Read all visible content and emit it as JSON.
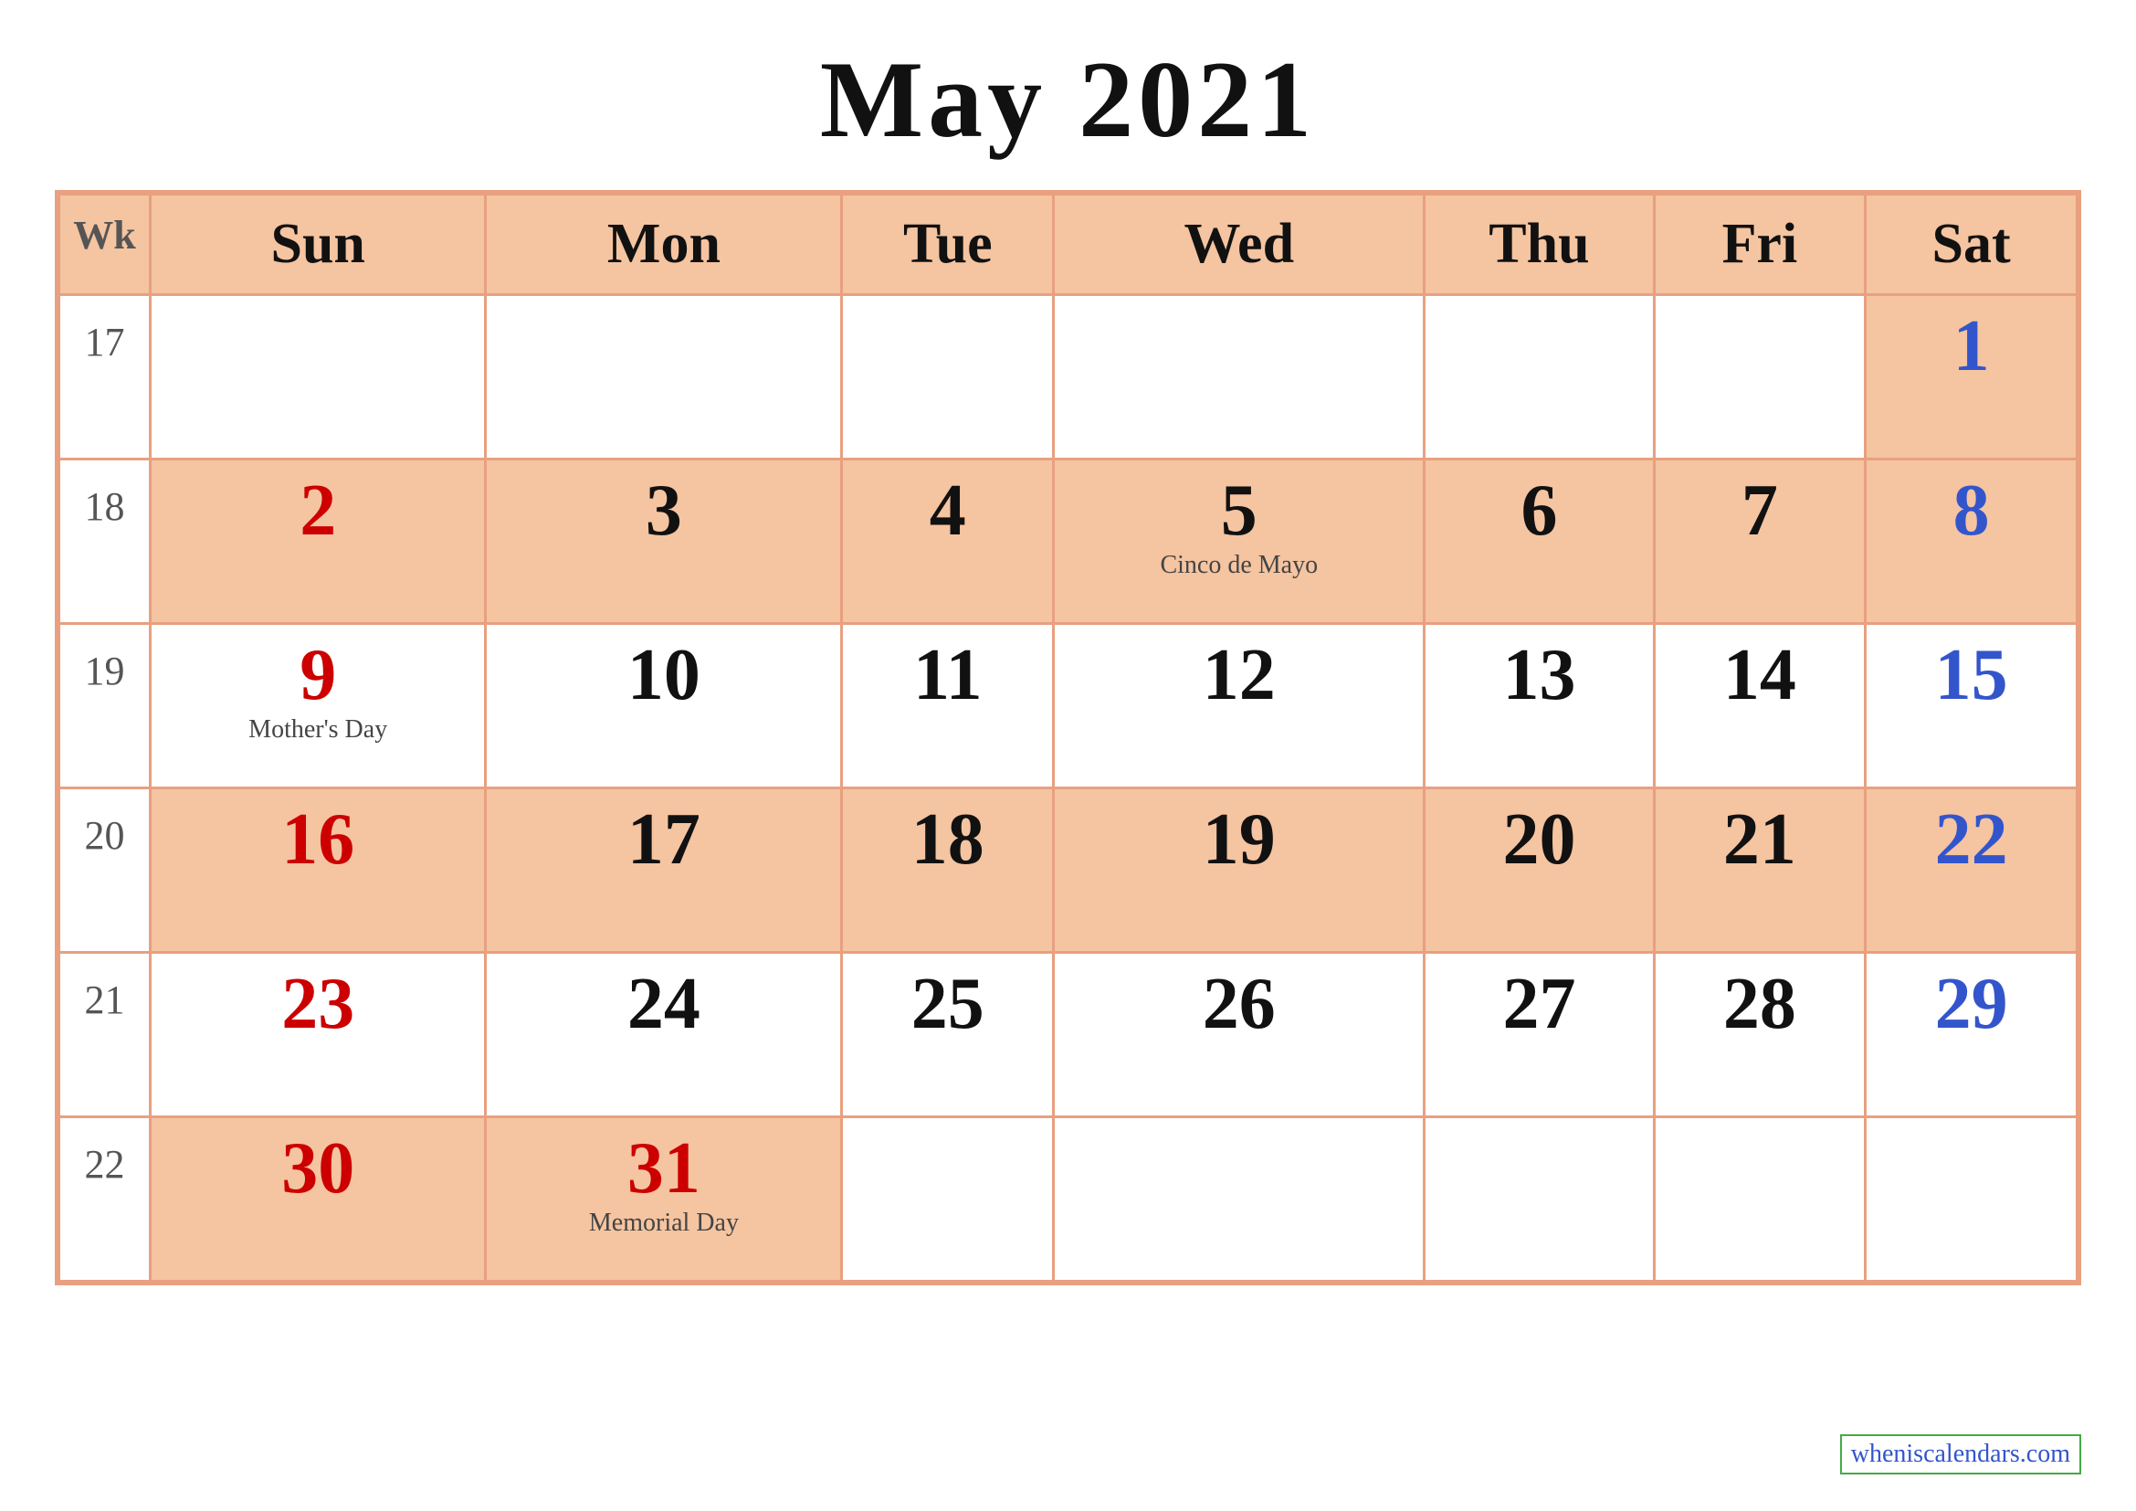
{
  "title": "May 2021",
  "headers": {
    "wk": "Wk",
    "sun": "Sun",
    "mon": "Mon",
    "tue": "Tue",
    "wed": "Wed",
    "thu": "Thu",
    "fri": "Fri",
    "sat": "Sat"
  },
  "weeks": [
    {
      "wk": "17",
      "days": [
        {
          "num": "",
          "holiday": "",
          "colorClass": "sun-color",
          "empty": true
        },
        {
          "num": "",
          "holiday": "",
          "colorClass": "weekday-color",
          "empty": true
        },
        {
          "num": "",
          "holiday": "",
          "colorClass": "weekday-color",
          "empty": true
        },
        {
          "num": "",
          "holiday": "",
          "colorClass": "weekday-color",
          "empty": true
        },
        {
          "num": "",
          "holiday": "",
          "colorClass": "weekday-color",
          "empty": true
        },
        {
          "num": "",
          "holiday": "",
          "colorClass": "weekday-color",
          "empty": true
        },
        {
          "num": "1",
          "holiday": "",
          "colorClass": "sat-color",
          "empty": false
        }
      ]
    },
    {
      "wk": "18",
      "days": [
        {
          "num": "2",
          "holiday": "",
          "colorClass": "sun-color",
          "empty": false
        },
        {
          "num": "3",
          "holiday": "",
          "colorClass": "weekday-color",
          "empty": false
        },
        {
          "num": "4",
          "holiday": "",
          "colorClass": "weekday-color",
          "empty": false
        },
        {
          "num": "5",
          "holiday": "Cinco de Mayo",
          "colorClass": "weekday-color",
          "empty": false
        },
        {
          "num": "6",
          "holiday": "",
          "colorClass": "weekday-color",
          "empty": false
        },
        {
          "num": "7",
          "holiday": "",
          "colorClass": "weekday-color",
          "empty": false
        },
        {
          "num": "8",
          "holiday": "",
          "colorClass": "sat-color",
          "empty": false
        }
      ]
    },
    {
      "wk": "19",
      "days": [
        {
          "num": "9",
          "holiday": "Mother's Day",
          "colorClass": "sun-color",
          "empty": false
        },
        {
          "num": "10",
          "holiday": "",
          "colorClass": "weekday-color",
          "empty": false
        },
        {
          "num": "11",
          "holiday": "",
          "colorClass": "weekday-color",
          "empty": false
        },
        {
          "num": "12",
          "holiday": "",
          "colorClass": "weekday-color",
          "empty": false
        },
        {
          "num": "13",
          "holiday": "",
          "colorClass": "weekday-color",
          "empty": false
        },
        {
          "num": "14",
          "holiday": "",
          "colorClass": "weekday-color",
          "empty": false
        },
        {
          "num": "15",
          "holiday": "",
          "colorClass": "sat-color",
          "empty": false
        }
      ]
    },
    {
      "wk": "20",
      "days": [
        {
          "num": "16",
          "holiday": "",
          "colorClass": "sun-color",
          "empty": false
        },
        {
          "num": "17",
          "holiday": "",
          "colorClass": "weekday-color",
          "empty": false
        },
        {
          "num": "18",
          "holiday": "",
          "colorClass": "weekday-color",
          "empty": false
        },
        {
          "num": "19",
          "holiday": "",
          "colorClass": "weekday-color",
          "empty": false
        },
        {
          "num": "20",
          "holiday": "",
          "colorClass": "weekday-color",
          "empty": false
        },
        {
          "num": "21",
          "holiday": "",
          "colorClass": "weekday-color",
          "empty": false
        },
        {
          "num": "22",
          "holiday": "",
          "colorClass": "sat-color",
          "empty": false
        }
      ]
    },
    {
      "wk": "21",
      "days": [
        {
          "num": "23",
          "holiday": "",
          "colorClass": "sun-color",
          "empty": false
        },
        {
          "num": "24",
          "holiday": "",
          "colorClass": "weekday-color",
          "empty": false
        },
        {
          "num": "25",
          "holiday": "",
          "colorClass": "weekday-color",
          "empty": false
        },
        {
          "num": "26",
          "holiday": "",
          "colorClass": "weekday-color",
          "empty": false
        },
        {
          "num": "27",
          "holiday": "",
          "colorClass": "weekday-color",
          "empty": false
        },
        {
          "num": "28",
          "holiday": "",
          "colorClass": "weekday-color",
          "empty": false
        },
        {
          "num": "29",
          "holiday": "",
          "colorClass": "sat-color",
          "empty": false
        }
      ]
    },
    {
      "wk": "22",
      "days": [
        {
          "num": "30",
          "holiday": "",
          "colorClass": "sun-color",
          "empty": false
        },
        {
          "num": "31",
          "holiday": "Memorial Day",
          "colorClass": "holiday-red",
          "empty": false
        },
        {
          "num": "",
          "holiday": "",
          "colorClass": "weekday-color",
          "empty": true
        },
        {
          "num": "",
          "holiday": "",
          "colorClass": "weekday-color",
          "empty": true
        },
        {
          "num": "",
          "holiday": "",
          "colorClass": "weekday-color",
          "empty": true
        },
        {
          "num": "",
          "holiday": "",
          "colorClass": "weekday-color",
          "empty": true
        },
        {
          "num": "",
          "holiday": "",
          "colorClass": "sat-color",
          "empty": true
        }
      ]
    }
  ],
  "watermark": "wheniscalendars.com",
  "colors": {
    "cellBg": "#f5c4a0",
    "border": "#e8a080",
    "headerBg": "#f5c4a0",
    "sunRed": "#cc0000",
    "satBlue": "#3355cc",
    "weekday": "#111111"
  }
}
